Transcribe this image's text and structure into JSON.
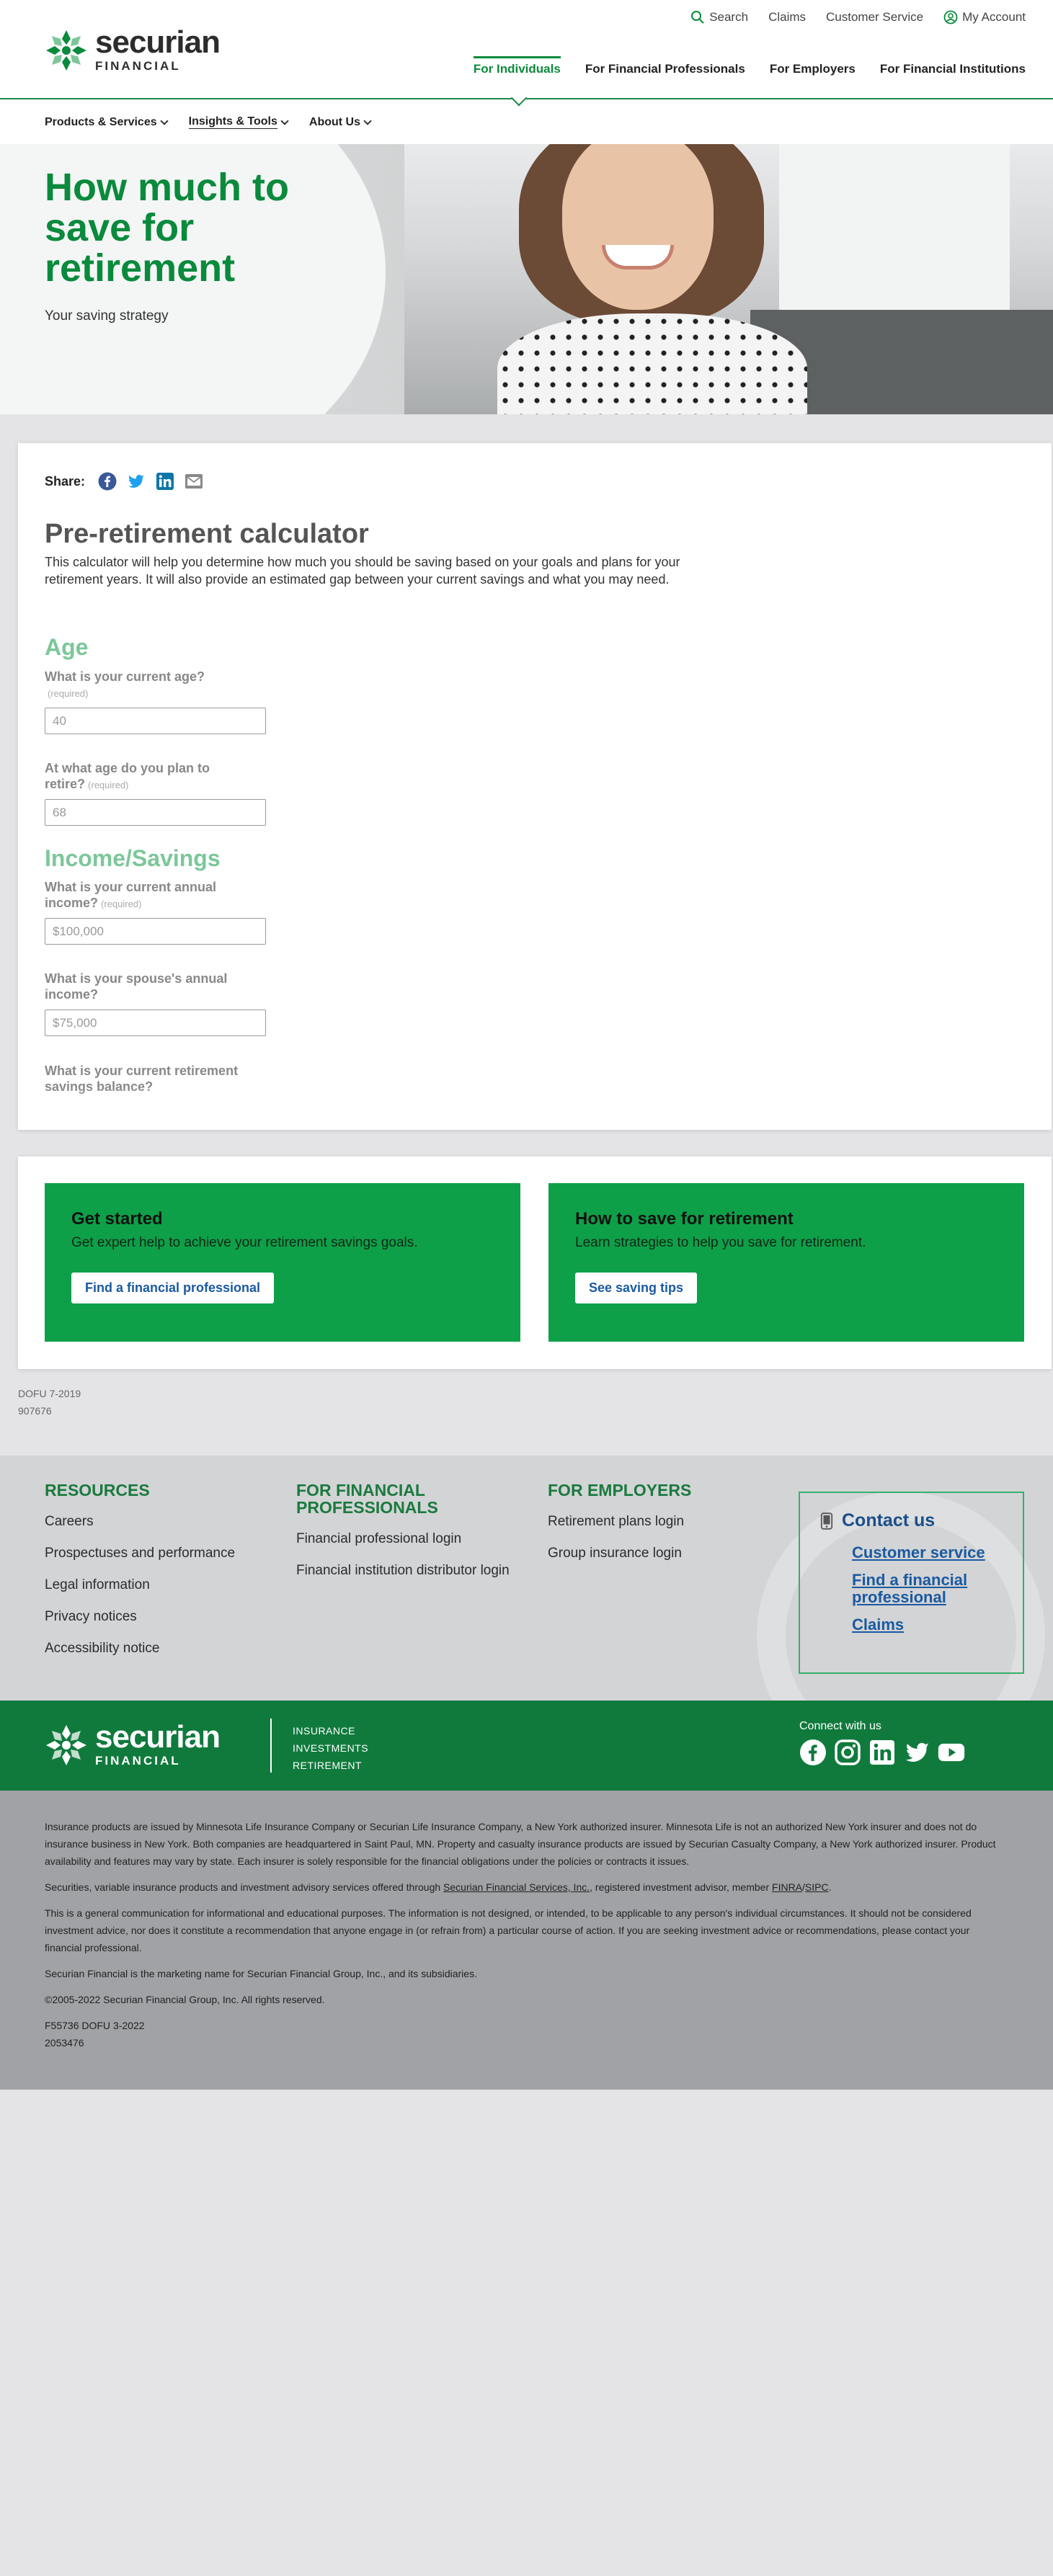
{
  "header": {
    "logo_big": "securian",
    "logo_small": "FINANCIAL",
    "utility": [
      "Search",
      "Claims",
      "Customer Service",
      "My Account"
    ],
    "main_nav": [
      "For Individuals",
      "For Financial Professionals",
      "For Employers",
      "For Financial Institutions"
    ],
    "sub_nav": [
      "Products & Services",
      "Insights & Tools",
      "About Us"
    ]
  },
  "hero": {
    "title": "How much to save for retirement",
    "subtitle": "Your saving strategy"
  },
  "calc": {
    "share_label": "Share:",
    "title": "Pre-retirement calculator",
    "intro": "This calculator will help you determine how much you should be saving based on your goals and plans for your retirement years. It will also provide an estimated gap between your current savings and what you may need.",
    "age_title": "Age",
    "q1": "What is your current age?",
    "required": "(required)",
    "q1_value": "40",
    "q2": "At what age do you plan to retire?",
    "q2_value": "68",
    "income_title": "Income/Savings",
    "q3": "What is your current annual income?",
    "q3_value": "$100,000",
    "q4": "What is your spouse's annual income?",
    "q4_value": "$75,000",
    "q5": "What is your current retirement savings balance?"
  },
  "cta": {
    "tile1": {
      "title": "Get started",
      "text": "Get expert help to achieve your retirement savings goals.",
      "button": "Find a financial professional"
    },
    "tile2": {
      "title": "How to save for retirement",
      "text": "Learn strategies to help you save for retirement.",
      "button": "See saving tips"
    }
  },
  "codes": [
    "DOFU 7-2019",
    "907676"
  ],
  "footer": {
    "resources_title": "RESOURCES",
    "resources": [
      "Careers",
      "Prospectuses and performance",
      "Legal information",
      "Privacy notices",
      "Accessibility notice"
    ],
    "fp_title": "FOR FINANCIAL PROFESSIONALS",
    "fp_links": [
      "Financial professional login",
      "Financial institution distributor login"
    ],
    "emp_title": "FOR EMPLOYERS",
    "emp_links": [
      "Retirement plans login",
      "Group insurance login"
    ],
    "contact_title": "Contact us",
    "contact_links": [
      "Customer service",
      "Find a financial professional",
      "Claims"
    ]
  },
  "brand": {
    "logo_big": "securian",
    "logo_small": "FINANCIAL",
    "tags": [
      "INSURANCE",
      "INVESTMENTS",
      "RETIREMENT"
    ],
    "connect": "Connect with us"
  },
  "legal": {
    "p1": "Insurance products are issued by Minnesota Life Insurance Company or Securian Life Insurance Company, a New York authorized insurer. Minnesota Life is not an authorized New York insurer and does not do insurance business in New York. Both companies are headquartered in Saint Paul, MN. Property and casualty insurance products are issued by Securian Casualty Company, a New York authorized insurer. Product availability and features may vary by state. Each insurer is solely responsible for the financial obligations under the policies or contracts it issues.",
    "p2_a": "Securities, variable insurance products and investment advisory services offered through ",
    "p2_link": "Securian Financial Services, Inc.",
    "p2_b": ", registered investment advisor, member ",
    "p2_finra": "FINRA",
    "p2_slash": "/",
    "p2_sipc": "SIPC",
    "p2_end": ".",
    "p3": "This is a general communication for informational and educational purposes. The information is not designed, or intended, to be applicable to any person's individual circumstances. It should not be considered investment advice, nor does it constitute a recommendation that anyone engage in (or refrain from) a particular course of action. If you are seeking investment advice or recommendations, please contact your financial professional.",
    "p4": "Securian Financial is the marketing name for Securian Financial Group, Inc., and its subsidiaries.",
    "p5": "©2005-2022 Securian Financial Group, Inc. All rights reserved.",
    "p6a": "F55736 DOFU 3-2022",
    "p6b": "2053476"
  }
}
